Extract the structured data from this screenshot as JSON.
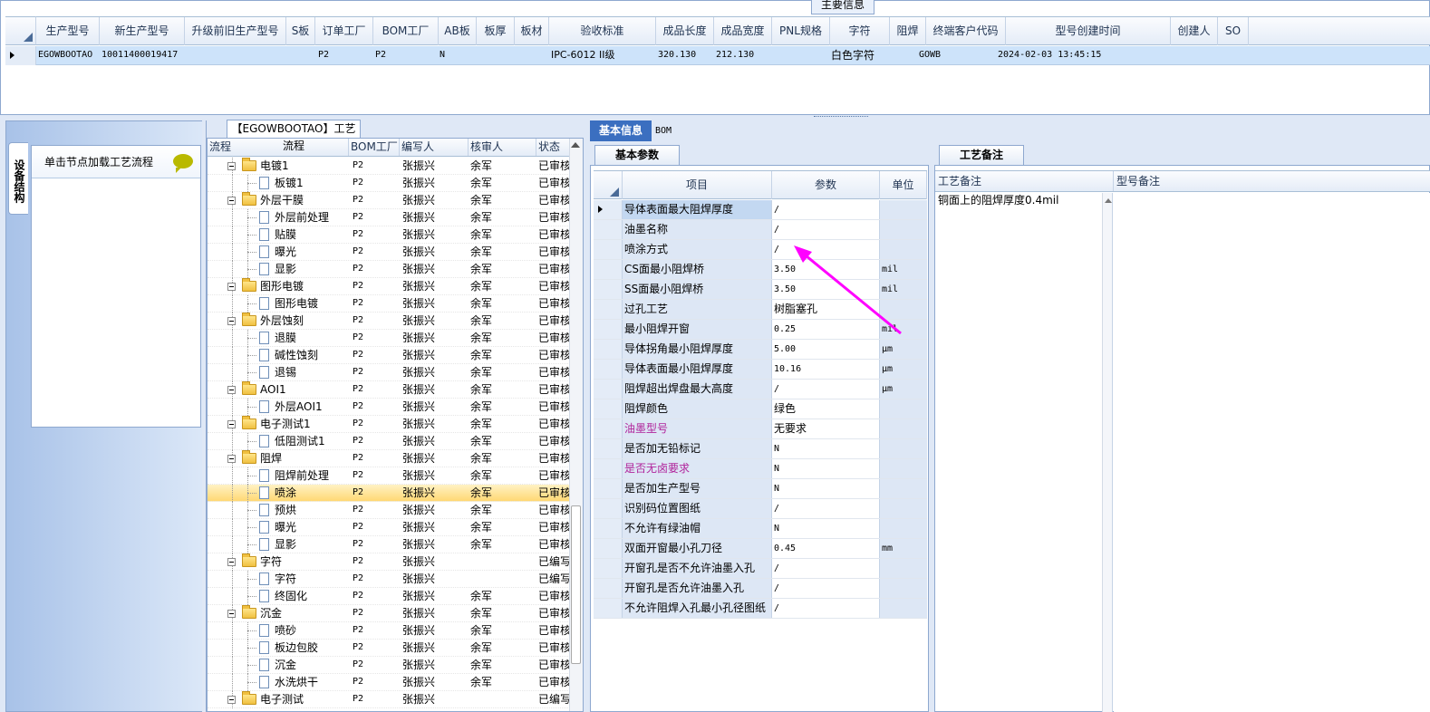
{
  "top": {
    "caption": "主要信息",
    "columns": [
      "生产型号",
      "新生产型号",
      "升级前旧生产型号",
      "S板",
      "订单工厂",
      "BOM工厂",
      "AB板",
      "板厚",
      "板材",
      "验收标准",
      "成品长度",
      "成品宽度",
      "PNL规格",
      "字符",
      "阻焊",
      "终端客户代码",
      "型号创建时间",
      "创建人",
      "SO"
    ],
    "row": {
      "model": "EGOWBOOTAO",
      "new_model": "10011400019417",
      "order_factory": "P2",
      "bom_factory": "P2",
      "ab_board": "N",
      "standard": "IPC-6012 II级",
      "length": "320.130",
      "width": "212.130",
      "char": "白色字符",
      "customer_code": "GOWB",
      "created": "2024-02-03 13:45:15"
    }
  },
  "left": {
    "vertical_tab": "设备结构",
    "load_hint": "单击节点加载工艺流程"
  },
  "tree": {
    "caption": "【EGOWBOOTAO】工艺流程",
    "columns": [
      "流程",
      "BOM工厂",
      "编写人",
      "核审人",
      "状态"
    ],
    "rows": [
      {
        "name": "电镀1",
        "level": 0,
        "factory": "P2",
        "writer": "张振兴",
        "reviewer": "余军",
        "status": "已审核"
      },
      {
        "name": "板镀1",
        "level": 1,
        "factory": "P2",
        "writer": "张振兴",
        "reviewer": "余军",
        "status": "已审核"
      },
      {
        "name": "外层干膜",
        "level": 0,
        "factory": "P2",
        "writer": "张振兴",
        "reviewer": "余军",
        "status": "已审核"
      },
      {
        "name": "外层前处理",
        "level": 1,
        "factory": "P2",
        "writer": "张振兴",
        "reviewer": "余军",
        "status": "已审核"
      },
      {
        "name": "贴膜",
        "level": 1,
        "factory": "P2",
        "writer": "张振兴",
        "reviewer": "余军",
        "status": "已审核"
      },
      {
        "name": "曝光",
        "level": 1,
        "factory": "P2",
        "writer": "张振兴",
        "reviewer": "余军",
        "status": "已审核"
      },
      {
        "name": "显影",
        "level": 1,
        "factory": "P2",
        "writer": "张振兴",
        "reviewer": "余军",
        "status": "已审核"
      },
      {
        "name": "图形电镀",
        "level": 0,
        "factory": "P2",
        "writer": "张振兴",
        "reviewer": "余军",
        "status": "已审核"
      },
      {
        "name": "图形电镀",
        "level": 1,
        "factory": "P2",
        "writer": "张振兴",
        "reviewer": "余军",
        "status": "已审核"
      },
      {
        "name": "外层蚀刻",
        "level": 0,
        "factory": "P2",
        "writer": "张振兴",
        "reviewer": "余军",
        "status": "已审核"
      },
      {
        "name": "退膜",
        "level": 1,
        "factory": "P2",
        "writer": "张振兴",
        "reviewer": "余军",
        "status": "已审核"
      },
      {
        "name": "碱性蚀刻",
        "level": 1,
        "factory": "P2",
        "writer": "张振兴",
        "reviewer": "余军",
        "status": "已审核"
      },
      {
        "name": "退锡",
        "level": 1,
        "factory": "P2",
        "writer": "张振兴",
        "reviewer": "余军",
        "status": "已审核"
      },
      {
        "name": "AOI1",
        "level": 0,
        "factory": "P2",
        "writer": "张振兴",
        "reviewer": "余军",
        "status": "已审核"
      },
      {
        "name": "外层AOI1",
        "level": 1,
        "factory": "P2",
        "writer": "张振兴",
        "reviewer": "余军",
        "status": "已审核"
      },
      {
        "name": "电子测试1",
        "level": 0,
        "factory": "P2",
        "writer": "张振兴",
        "reviewer": "余军",
        "status": "已审核"
      },
      {
        "name": "低阻测试1",
        "level": 1,
        "factory": "P2",
        "writer": "张振兴",
        "reviewer": "余军",
        "status": "已审核"
      },
      {
        "name": "阻焊",
        "level": 0,
        "factory": "P2",
        "writer": "张振兴",
        "reviewer": "余军",
        "status": "已审核"
      },
      {
        "name": "阻焊前处理",
        "level": 1,
        "factory": "P2",
        "writer": "张振兴",
        "reviewer": "余军",
        "status": "已审核"
      },
      {
        "name": "喷涂",
        "level": 1,
        "factory": "P2",
        "writer": "张振兴",
        "reviewer": "余军",
        "status": "已审核",
        "selected": true
      },
      {
        "name": "预烘",
        "level": 1,
        "factory": "P2",
        "writer": "张振兴",
        "reviewer": "余军",
        "status": "已审核"
      },
      {
        "name": "曝光",
        "level": 1,
        "factory": "P2",
        "writer": "张振兴",
        "reviewer": "余军",
        "status": "已审核"
      },
      {
        "name": "显影",
        "level": 1,
        "factory": "P2",
        "writer": "张振兴",
        "reviewer": "余军",
        "status": "已审核"
      },
      {
        "name": "字符",
        "level": 0,
        "factory": "P2",
        "writer": "张振兴",
        "reviewer": "",
        "status": "已编写"
      },
      {
        "name": "字符",
        "level": 1,
        "factory": "P2",
        "writer": "张振兴",
        "reviewer": "",
        "status": "已编写"
      },
      {
        "name": "终固化",
        "level": 1,
        "factory": "P2",
        "writer": "张振兴",
        "reviewer": "余军",
        "status": "已审核"
      },
      {
        "name": "沉金",
        "level": 0,
        "factory": "P2",
        "writer": "张振兴",
        "reviewer": "余军",
        "status": "已审核"
      },
      {
        "name": "喷砂",
        "level": 1,
        "factory": "P2",
        "writer": "张振兴",
        "reviewer": "余军",
        "status": "已审核"
      },
      {
        "name": "板边包胶",
        "level": 1,
        "factory": "P2",
        "writer": "张振兴",
        "reviewer": "余军",
        "status": "已审核"
      },
      {
        "name": "沉金",
        "level": 1,
        "factory": "P2",
        "writer": "张振兴",
        "reviewer": "余军",
        "status": "已审核"
      },
      {
        "name": "水洗烘干",
        "level": 1,
        "factory": "P2",
        "writer": "张振兴",
        "reviewer": "余军",
        "status": "已审核"
      },
      {
        "name": "电子测试",
        "level": 0,
        "factory": "P2",
        "writer": "张振兴",
        "reviewer": "",
        "status": "已编写"
      }
    ]
  },
  "info_tabs": {
    "basic": "基本信息",
    "bom": "BOM"
  },
  "params": {
    "tab": "基本参数",
    "columns": [
      "项目",
      "参数",
      "单位"
    ],
    "rows": [
      {
        "item": "导体表面最大阻焊厚度",
        "value": "/",
        "unit": "",
        "current": true
      },
      {
        "item": "油墨名称",
        "value": "/",
        "unit": ""
      },
      {
        "item": "喷涂方式",
        "value": "/",
        "unit": ""
      },
      {
        "item": "CS面最小阻焊桥",
        "value": "3.50",
        "unit": "mil"
      },
      {
        "item": "SS面最小阻焊桥",
        "value": "3.50",
        "unit": "mil"
      },
      {
        "item": "过孔工艺",
        "value": "树脂塞孔",
        "unit": ""
      },
      {
        "item": "最小阻焊开窗",
        "value": "0.25",
        "unit": "mil"
      },
      {
        "item": "导体拐角最小阻焊厚度",
        "value": "5.00",
        "unit": "μm"
      },
      {
        "item": "导体表面最小阻焊厚度",
        "value": "10.16",
        "unit": "μm"
      },
      {
        "item": "阻焊超出焊盘最大高度",
        "value": "/",
        "unit": "μm"
      },
      {
        "item": "阻焊颜色",
        "value": "绿色",
        "unit": ""
      },
      {
        "item": "油墨型号",
        "value": "无要求",
        "unit": "",
        "purple": true
      },
      {
        "item": "是否加无铅标记",
        "value": "N",
        "unit": ""
      },
      {
        "item": "是否无卤要求",
        "value": "N",
        "unit": "",
        "purple": true
      },
      {
        "item": "是否加生产型号",
        "value": "N",
        "unit": ""
      },
      {
        "item": "识别码位置图纸",
        "value": "/",
        "unit": ""
      },
      {
        "item": "不允许有绿油帽",
        "value": "N",
        "unit": ""
      },
      {
        "item": "双面开窗最小孔刀径",
        "value": "0.45",
        "unit": "mm"
      },
      {
        "item": "开窗孔是否不允许油墨入孔",
        "value": "/",
        "unit": ""
      },
      {
        "item": "开窗孔是否允许油墨入孔",
        "value": "/",
        "unit": ""
      },
      {
        "item": "不允许阻焊入孔最小孔径图纸",
        "value": "/",
        "unit": ""
      }
    ]
  },
  "remarks": {
    "tab": "工艺备注",
    "col_process": "工艺备注",
    "col_model": "型号备注",
    "text": "铜面上的阻焊厚度0.4mil"
  },
  "colors": {
    "accent": "#3b6fc0",
    "selected_row": "#cde3fa",
    "tree_selected": "#ffd874",
    "highlight_label": "#b0239b",
    "annotation_arrow": "#ff00ff"
  }
}
